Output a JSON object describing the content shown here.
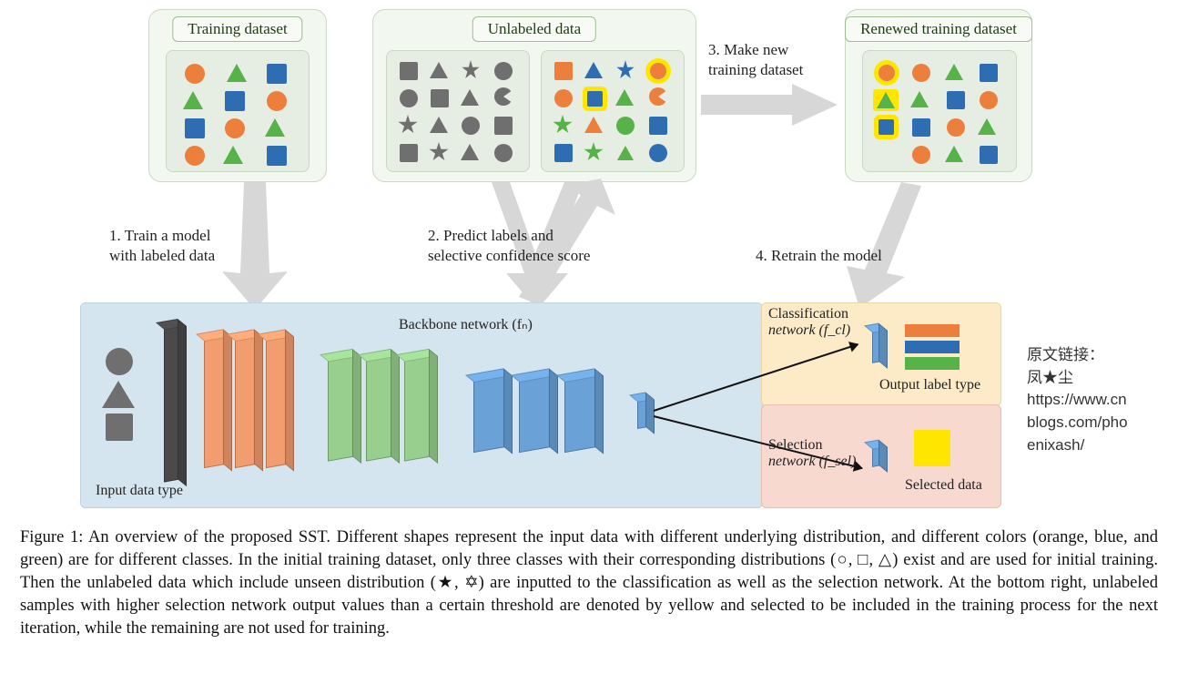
{
  "panels": {
    "training": "Training dataset",
    "unlabeled": "Unlabeled data",
    "renewed": "Renewed training dataset"
  },
  "steps": {
    "s1_line1": "1. Train a model",
    "s1_line2": "with labeled data",
    "s2_line1": "2. Predict labels and",
    "s2_line2": "selective confidence score",
    "s3_line1": "3. Make new",
    "s3_line2": "training dataset",
    "s4": "4. Retrain the model"
  },
  "network": {
    "backbone": "Backbone network (fₙ)",
    "input_label": "Input data type",
    "cls_label_1": "Classification",
    "cls_label_2": "network (f_cl)",
    "sel_label_1": "Selection",
    "sel_label_2": "network (f_sel)",
    "output_label": "Output label type",
    "selected_label": "Selected data"
  },
  "sidebar": {
    "l1": "原文链接：",
    "l2": "凤★尘",
    "l3": "https://www.cn",
    "l4": "blogs.com/pho",
    "l5": "enixash/"
  },
  "caption": "Figure 1: An overview of the proposed SST. Different shapes represent the input data with different underlying distribution, and different colors (orange, blue, and green) are for different classes. In the initial training dataset, only three classes with their corresponding distributions (○, □, △) exist and are used for initial training. Then the unlabeled data which include unseen distribution (★, ✡) are inputted to the classification as well as the selection network. At the bottom right, unlabeled samples with higher selection network output values than a certain threshold are denoted by yellow and selected to be included in the training process for the next iteration, while the remaining are not used for training.",
  "colors": {
    "orange": "#ec7f3c",
    "blue": "#2f6db3",
    "green": "#58b24a",
    "gray": "#6f6f6f",
    "yellow": "#ffe600"
  },
  "shapes_legend": [
    "circle",
    "square",
    "triangle",
    "star5",
    "star6",
    "pacman"
  ]
}
